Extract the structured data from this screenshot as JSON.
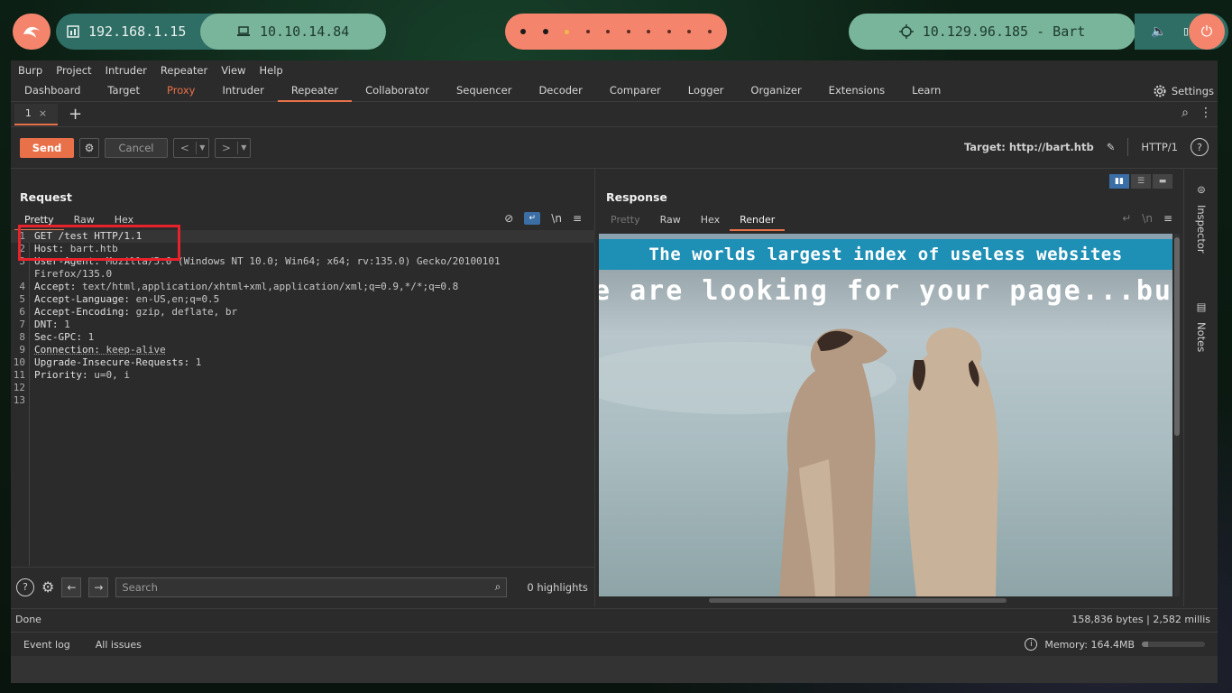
{
  "topbar": {
    "ip_local": "192.168.1.15",
    "ip_vpn": "10.10.14.84",
    "target": "10.129.96.185 - Bart"
  },
  "menu": [
    "Burp",
    "Project",
    "Intruder",
    "Repeater",
    "View",
    "Help"
  ],
  "tabs": [
    "Dashboard",
    "Target",
    "Proxy",
    "Intruder",
    "Repeater",
    "Collaborator",
    "Sequencer",
    "Decoder",
    "Comparer",
    "Logger",
    "Organizer",
    "Extensions",
    "Learn"
  ],
  "active_tab": "Repeater",
  "settings_label": "Settings",
  "subtab_label": "1",
  "toolbar": {
    "send": "Send",
    "cancel": "Cancel",
    "target_label": "Target: http://bart.htb",
    "protocol": "HTTP/1"
  },
  "request": {
    "title": "Request",
    "view_tabs": [
      "Pretty",
      "Raw",
      "Hex"
    ],
    "lines": [
      {
        "n": "1",
        "key": "GET /test HTTP/1.1",
        "val": ""
      },
      {
        "n": "2",
        "key": "Host:",
        "val": " bart.htb"
      },
      {
        "n": "3",
        "key": "User-Agent:",
        "val": " Mozilla/5.0 (Windows NT 10.0; Win64; x64; rv:135.0) Gecko/20100101"
      },
      {
        "n": "",
        "key": "",
        "val": "Firefox/135.0"
      },
      {
        "n": "4",
        "key": "Accept:",
        "val": " text/html,application/xhtml+xml,application/xml;q=0.9,*/*;q=0.8"
      },
      {
        "n": "5",
        "key": "Accept-Language:",
        "val": " en-US,en;q=0.5"
      },
      {
        "n": "6",
        "key": "Accept-Encoding:",
        "val": " gzip, deflate, br"
      },
      {
        "n": "7",
        "key": "DNT:",
        "val": " 1"
      },
      {
        "n": "8",
        "key": "Sec-GPC:",
        "val": " 1"
      },
      {
        "n": "9",
        "key": "Connection:",
        "val": " keep-alive"
      },
      {
        "n": "10",
        "key": "Upgrade-Insecure-Requests:",
        "val": " 1"
      },
      {
        "n": "11",
        "key": "Priority:",
        "val": " u=0, i"
      },
      {
        "n": "12",
        "key": "",
        "val": ""
      },
      {
        "n": "13",
        "key": "",
        "val": ""
      }
    ],
    "search_placeholder": "Search",
    "highlights": "0 highlights"
  },
  "response": {
    "title": "Response",
    "view_tabs": [
      "Pretty",
      "Raw",
      "Hex",
      "Render"
    ],
    "active_view": "Render",
    "render_banner": "The worlds largest index of useless websites",
    "render_hero": "e are looking for your page...but we car"
  },
  "side_panel": {
    "inspector": "Inspector",
    "notes": "Notes"
  },
  "status": {
    "left": "Done",
    "right": "158,836 bytes | 2,582 millis"
  },
  "bottom": {
    "event_log": "Event log",
    "all_issues": "All issues",
    "memory": "Memory: 164.4MB",
    "memory_fraction": 0.1
  },
  "colors": {
    "accent": "#e8714a",
    "highlight_box": "#e8222a"
  }
}
